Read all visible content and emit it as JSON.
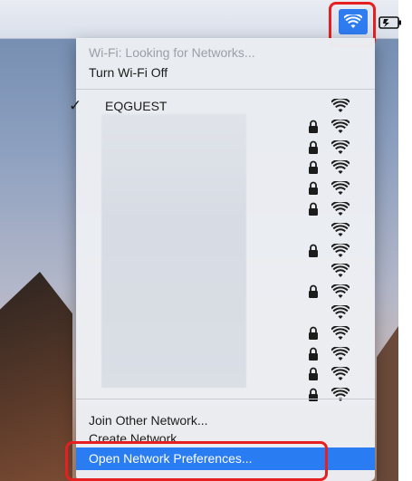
{
  "menubar": {
    "wifi_icon": "wifi-icon",
    "battery_icon": "battery-icon",
    "accent_color": "#2f7bf0",
    "highlight_color": "#e62020"
  },
  "wifi_menu": {
    "status": "Wi-Fi: Looking for Networks...",
    "toggle_label": "Turn Wi-Fi Off",
    "connected_network": "EQGUEST",
    "networks": [
      {
        "name": "EQGUEST",
        "secured": false,
        "connected": true
      },
      {
        "name": "",
        "secured": true,
        "connected": false
      },
      {
        "name": "",
        "secured": true,
        "connected": false
      },
      {
        "name": "",
        "secured": true,
        "connected": false
      },
      {
        "name": "",
        "secured": true,
        "connected": false
      },
      {
        "name": "",
        "secured": true,
        "connected": false
      },
      {
        "name": "",
        "secured": false,
        "connected": false
      },
      {
        "name": "",
        "secured": true,
        "connected": false
      },
      {
        "name": "",
        "secured": false,
        "connected": false
      },
      {
        "name": "",
        "secured": true,
        "connected": false
      },
      {
        "name": "",
        "secured": false,
        "connected": false
      },
      {
        "name": "",
        "secured": true,
        "connected": false
      },
      {
        "name": "",
        "secured": true,
        "connected": false
      },
      {
        "name": "",
        "secured": true,
        "connected": false
      },
      {
        "name": "",
        "secured": true,
        "connected": false
      }
    ],
    "join_other": "Join Other Network...",
    "create_network": "Create Network...",
    "open_preferences": "Open Network Preferences...",
    "selected_color": "#2a7cf3"
  }
}
